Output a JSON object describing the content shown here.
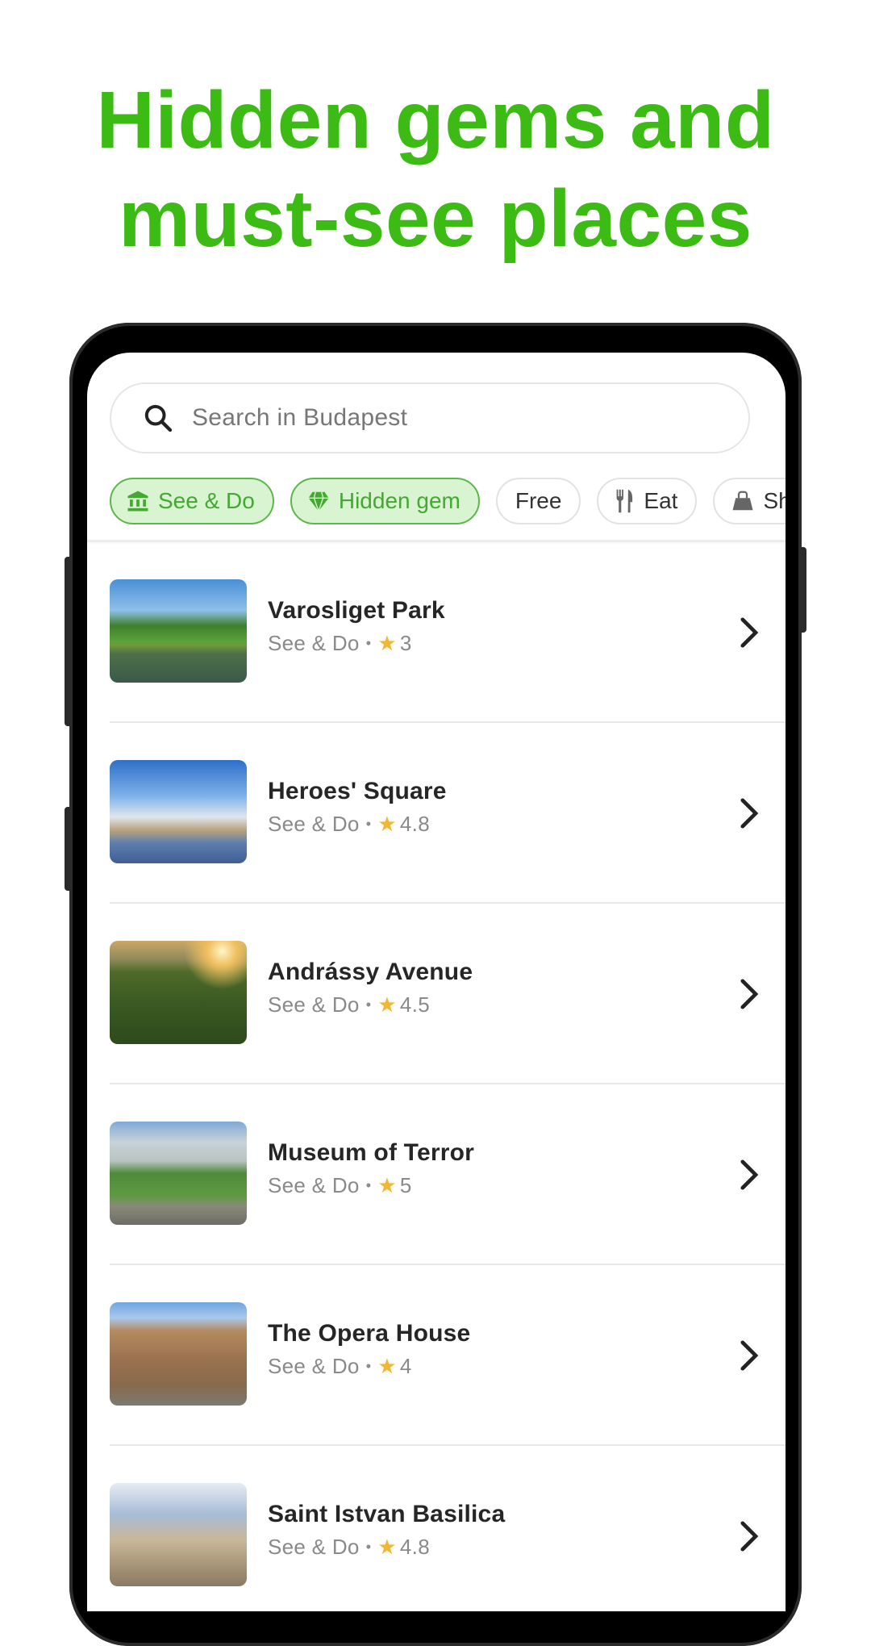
{
  "headline": {
    "line1": "Hidden gems and",
    "line2": "must-see places"
  },
  "search": {
    "placeholder": "Search in Budapest",
    "icon": "search-icon"
  },
  "chips": [
    {
      "label": "See & Do",
      "icon": "museum-icon",
      "active": true
    },
    {
      "label": "Hidden gem",
      "icon": "diamond-icon",
      "active": true
    },
    {
      "label": "Free",
      "icon": null,
      "active": false
    },
    {
      "label": "Eat",
      "icon": "fork-knife-icon",
      "active": false
    },
    {
      "label": "Sh",
      "icon": "shopping-bag-icon",
      "active": false
    }
  ],
  "places": [
    {
      "name": "Varosliget Park",
      "category": "See & Do",
      "rating": "3"
    },
    {
      "name": "Heroes' Square",
      "category": "See & Do",
      "rating": "4.8"
    },
    {
      "name": "Andrássy Avenue",
      "category": "See & Do",
      "rating": "4.5"
    },
    {
      "name": "Museum of Terror",
      "category": "See & Do",
      "rating": "5"
    },
    {
      "name": "The Opera House",
      "category": "See & Do",
      "rating": "4"
    },
    {
      "name": "Saint Istvan Basilica",
      "category": "See & Do",
      "rating": "4.8"
    }
  ],
  "glyphs": {
    "separator": "•",
    "star": "★"
  },
  "colors": {
    "headline": "#3bbb14",
    "chip_active_bg": "#d8f4d0",
    "chip_active_border": "#5cb74a",
    "star": "#f2b632"
  }
}
